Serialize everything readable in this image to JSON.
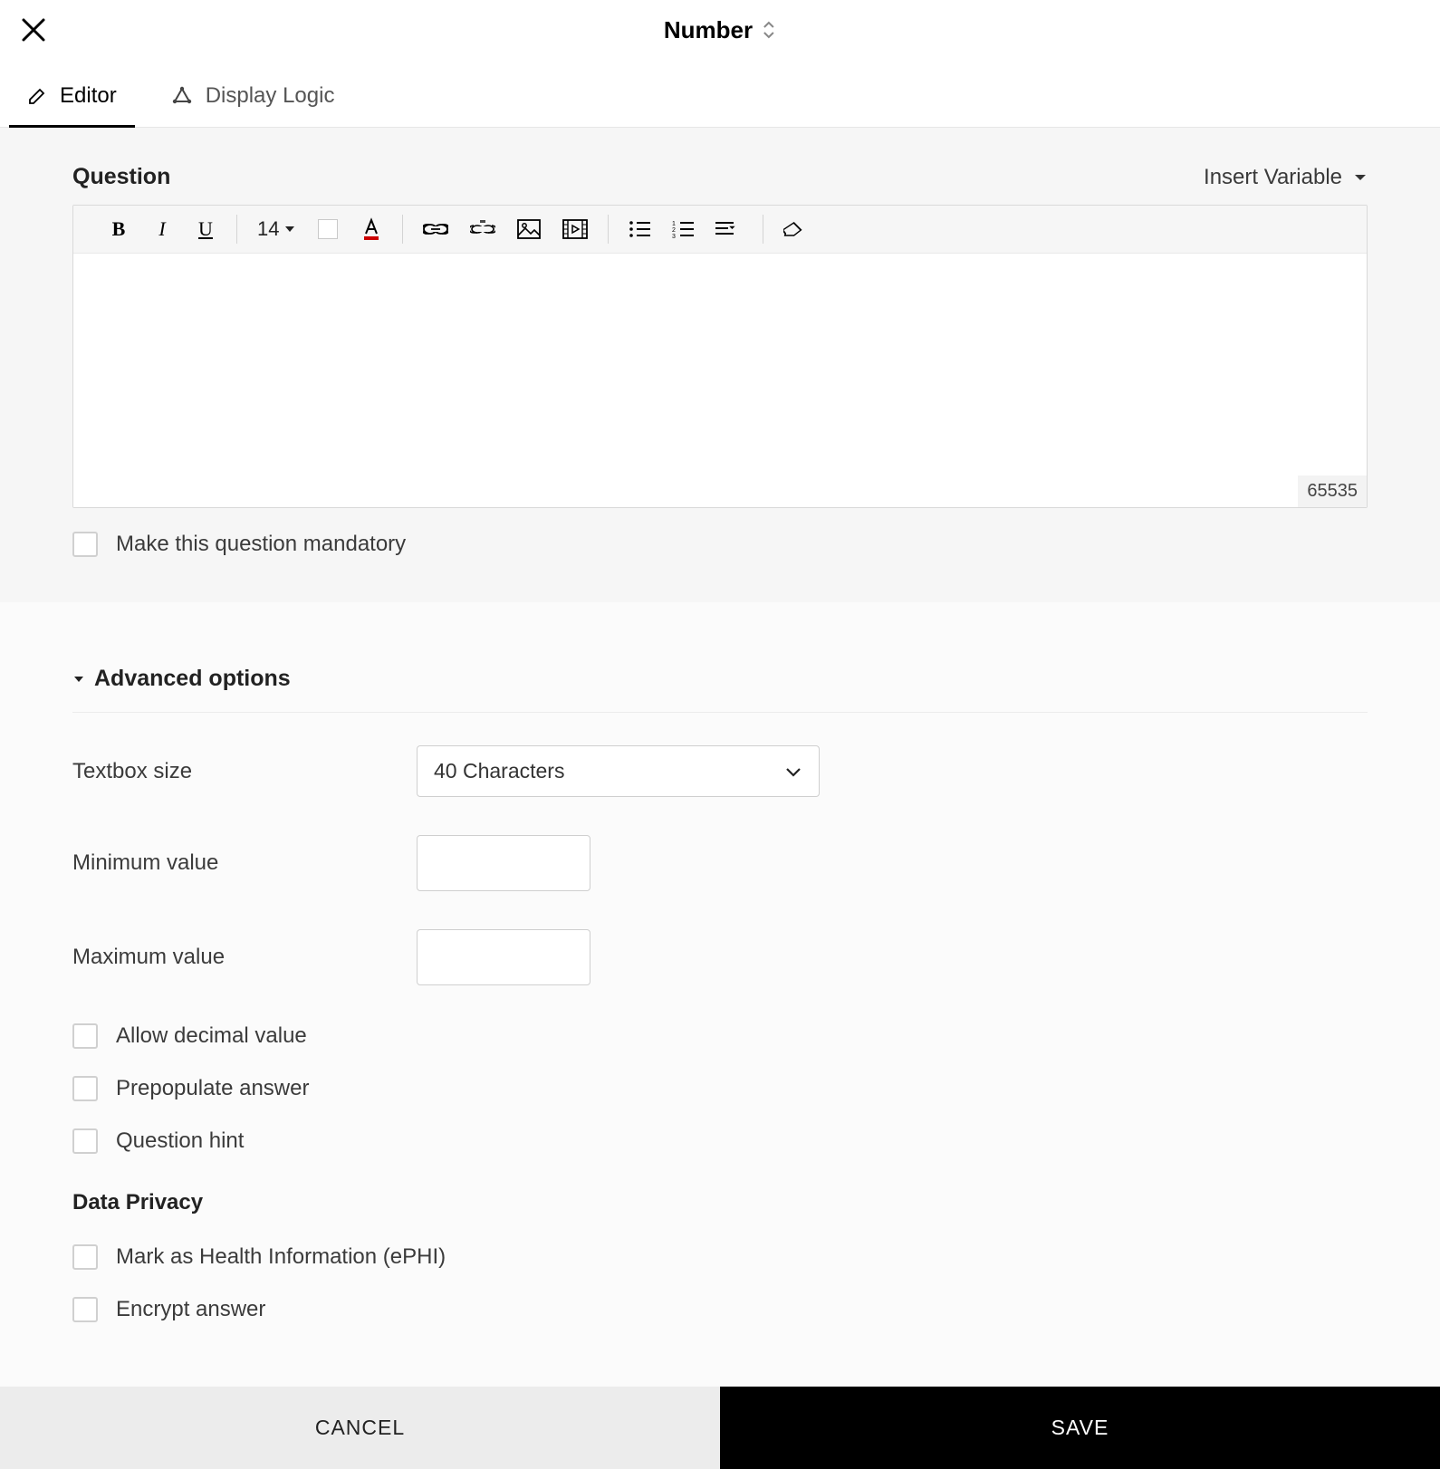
{
  "header": {
    "title": "Number"
  },
  "tabs": {
    "editor": "Editor",
    "displayLogic": "Display Logic"
  },
  "question": {
    "label": "Question",
    "insertVariable": "Insert Variable",
    "fontSize": "14",
    "charCount": "65535",
    "mandatory": "Make this question mandatory"
  },
  "advanced": {
    "heading": "Advanced options",
    "textboxSizeLabel": "Textbox size",
    "textboxSizeValue": "40 Characters",
    "minLabel": "Minimum value",
    "minValue": "",
    "maxLabel": "Maximum value",
    "maxValue": "",
    "allowDecimal": "Allow decimal value",
    "prepopulate": "Prepopulate answer",
    "hint": "Question hint"
  },
  "privacy": {
    "heading": "Data Privacy",
    "ephi": "Mark as Health Information (ePHI)",
    "encrypt": "Encrypt answer"
  },
  "footer": {
    "cancel": "CANCEL",
    "save": "SAVE"
  }
}
